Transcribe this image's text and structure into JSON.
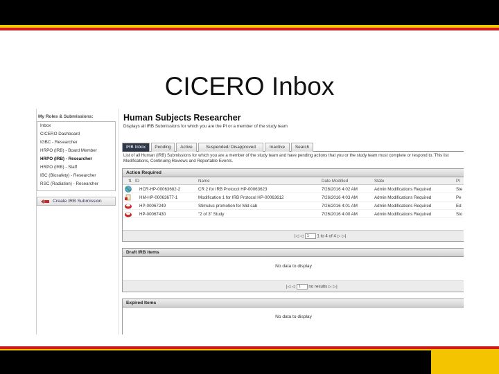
{
  "slide": {
    "title": "CICERO Inbox"
  },
  "sidebar": {
    "heading": "My Roles & Submissions:",
    "items": [
      {
        "label": "Inbox",
        "bold": false
      },
      {
        "label": "CICERO Dashboard",
        "bold": false
      },
      {
        "label": "IGBC - Researcher",
        "bold": false
      },
      {
        "label": "HRPO (IRB) - Board Member",
        "bold": false
      },
      {
        "label": "HRPO (IRB) - Researcher",
        "bold": true
      },
      {
        "label": "HRPO (IRB) - Staff",
        "bold": false
      },
      {
        "label": "IBC (Biosafety) - Researcher",
        "bold": false
      },
      {
        "label": "RSC (Radiation) - Researcher",
        "bold": false
      }
    ],
    "create_button": "Create IRB Submission"
  },
  "main": {
    "title": "Human Subjects Researcher",
    "description": "Displays all IRB Submissions for which you are the PI or a member of the study team",
    "tabs": [
      "IRB Inbox",
      "Pending",
      "Active",
      "Suspended/ Disapproved",
      "Inactive",
      "Search"
    ],
    "tab_description_line1": "List of all Human (IRB) Submissions for which you are a member of the study team and have pending actions that you or the study team must complete or respond to. This list",
    "tab_description_line2": "Modifications, Continuing Reviews and Reportable Events."
  },
  "action_required": {
    "heading": "Action Required",
    "columns": [
      "ID",
      "Name",
      "Date Modified",
      "State",
      "PI"
    ],
    "rows": [
      {
        "id": "HCR-HP-00063682-2",
        "name": "CR 2 for IRB Protocol HP-00063623",
        "date": "7/26/2016 4:02 AM",
        "state": "Admin Modifications Required",
        "pi": "Ste",
        "icon": "globe-icon"
      },
      {
        "id": "HM-HP-00063677-1",
        "name": "Modification 1 for IRB Protocol HP-00063612",
        "date": "7/26/2016 4:03 AM",
        "state": "Admin Modifications Required",
        "pi": "Pe",
        "icon": "document-icon"
      },
      {
        "id": "HP-00067249",
        "name": "Stimulus promotion for Mid cab",
        "date": "7/26/2016 4:01 AM",
        "state": "Admin Modifications Required",
        "pi": "Ed",
        "icon": "submission-icon"
      },
      {
        "id": "HP-00067430",
        "name": "\"2 of 3\" Study",
        "date": "7/26/2016 4:00 AM",
        "state": "Admin Modifications Required",
        "pi": "Sto",
        "icon": "submission-icon"
      }
    ],
    "pager": {
      "page_value": "1",
      "summary": "1 to 4 of 4"
    }
  },
  "draft_items": {
    "heading": "Draft IRB Items",
    "empty_text": "No data to display",
    "pager": {
      "page_value": "1",
      "summary": "no results"
    }
  },
  "expired_items": {
    "heading": "Expired Items",
    "empty_text": "No data to display"
  },
  "colors": {
    "active_tab": "#2d3748",
    "brand_red": "#d01b1b",
    "brand_yellow": "#f5c400"
  }
}
